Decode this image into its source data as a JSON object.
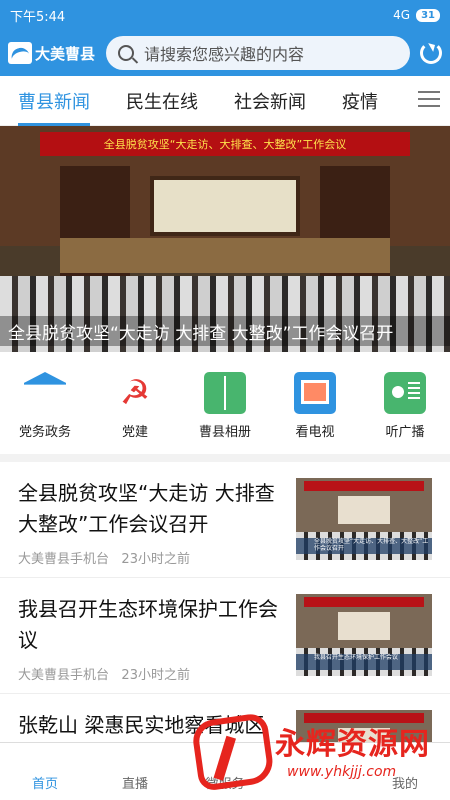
{
  "status": {
    "time": "下午5:44",
    "network": "4G",
    "battery": "31"
  },
  "header": {
    "logo_text": "大美曹县",
    "search_placeholder": "请搜索您感兴趣的内容"
  },
  "tabs": [
    "曹县新闻",
    "民生在线",
    "社会新闻",
    "疫情"
  ],
  "banner": {
    "stage_text": "全县脱贫攻坚“大走访、大排查、大整改”工作会议",
    "caption": "全县脱贫攻坚“大走访 大排查 大整改”工作会议召开"
  },
  "quick_links": [
    {
      "label": "党务政务",
      "icon": "government-icon"
    },
    {
      "label": "党建",
      "icon": "party-icon"
    },
    {
      "label": "曹县相册",
      "icon": "album-icon"
    },
    {
      "label": "看电视",
      "icon": "tv-icon"
    },
    {
      "label": "听广播",
      "icon": "radio-icon"
    }
  ],
  "news": [
    {
      "title": "全县脱贫攻坚“大走访 大排查 大整改”工作会议召开",
      "source": "大美曹县手机台",
      "time": "23小时之前",
      "thumb_caption": "全县脱贫攻坚“大走访、大排查、大整改”工作会议召开"
    },
    {
      "title": "我县召开生态环境保护工作会议",
      "source": "大美曹县手机台",
      "time": "23小时之前",
      "thumb_caption": "我县召开生态环境保护工作会议"
    },
    {
      "title": "张乾山 梁惠民实地察看城区",
      "source": "",
      "time": "",
      "thumb_caption": ""
    }
  ],
  "bottom_nav": [
    "首页",
    "直播",
    "微服务",
    "",
    "我的"
  ],
  "watermark": {
    "name": "永辉资源网",
    "url": "www.yhkjjj.com"
  }
}
